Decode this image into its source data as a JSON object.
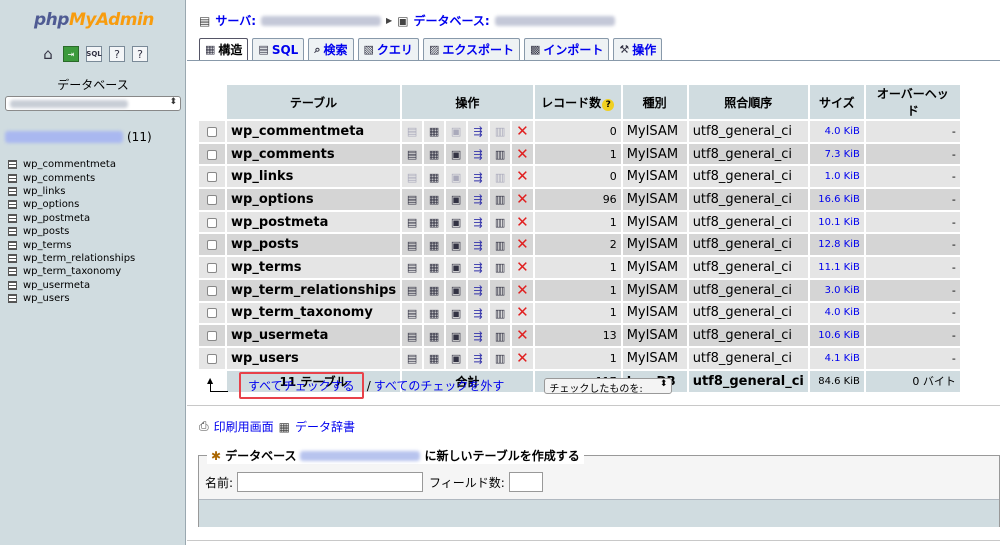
{
  "sidebar": {
    "logo": {
      "php": "php",
      "my": "My",
      "admin": "Admin"
    },
    "db_label": "データベース",
    "db_count": "(11)",
    "tables": [
      "wp_commentmeta",
      "wp_comments",
      "wp_links",
      "wp_options",
      "wp_postmeta",
      "wp_posts",
      "wp_terms",
      "wp_term_relationships",
      "wp_term_taxonomy",
      "wp_usermeta",
      "wp_users"
    ]
  },
  "breadcrumb": {
    "server_label": "サーバ:",
    "database_label": "データベース:"
  },
  "tabs": [
    {
      "label": "構造",
      "icon": "structure-icon"
    },
    {
      "label": "SQL",
      "icon": "sql-icon"
    },
    {
      "label": "検索",
      "icon": "search-icon"
    },
    {
      "label": "クエリ",
      "icon": "query-icon"
    },
    {
      "label": "エクスポート",
      "icon": "export-icon"
    },
    {
      "label": "インポート",
      "icon": "import-icon"
    },
    {
      "label": "操作",
      "icon": "operations-icon"
    }
  ],
  "table": {
    "headers": {
      "table": "テーブル",
      "actions": "操作",
      "records": "レコード数",
      "type": "種別",
      "collation": "照合順序",
      "size": "サイズ",
      "overhead": "オーバーヘッド"
    },
    "rows": [
      {
        "name": "wp_commentmeta",
        "records": "0",
        "type": "MyISAM",
        "collation": "utf8_general_ci",
        "size": "4.0 KiB",
        "overhead": "-",
        "empty": true
      },
      {
        "name": "wp_comments",
        "records": "1",
        "type": "MyISAM",
        "collation": "utf8_general_ci",
        "size": "7.3 KiB",
        "overhead": "-",
        "empty": false
      },
      {
        "name": "wp_links",
        "records": "0",
        "type": "MyISAM",
        "collation": "utf8_general_ci",
        "size": "1.0 KiB",
        "overhead": "-",
        "empty": true
      },
      {
        "name": "wp_options",
        "records": "96",
        "type": "MyISAM",
        "collation": "utf8_general_ci",
        "size": "16.6 KiB",
        "overhead": "-",
        "empty": false
      },
      {
        "name": "wp_postmeta",
        "records": "1",
        "type": "MyISAM",
        "collation": "utf8_general_ci",
        "size": "10.1 KiB",
        "overhead": "-",
        "empty": false
      },
      {
        "name": "wp_posts",
        "records": "2",
        "type": "MyISAM",
        "collation": "utf8_general_ci",
        "size": "12.8 KiB",
        "overhead": "-",
        "empty": false
      },
      {
        "name": "wp_terms",
        "records": "1",
        "type": "MyISAM",
        "collation": "utf8_general_ci",
        "size": "11.1 KiB",
        "overhead": "-",
        "empty": false
      },
      {
        "name": "wp_term_relationships",
        "records": "1",
        "type": "MyISAM",
        "collation": "utf8_general_ci",
        "size": "3.0 KiB",
        "overhead": "-",
        "empty": false
      },
      {
        "name": "wp_term_taxonomy",
        "records": "1",
        "type": "MyISAM",
        "collation": "utf8_general_ci",
        "size": "4.0 KiB",
        "overhead": "-",
        "empty": false
      },
      {
        "name": "wp_usermeta",
        "records": "13",
        "type": "MyISAM",
        "collation": "utf8_general_ci",
        "size": "10.6 KiB",
        "overhead": "-",
        "empty": false
      },
      {
        "name": "wp_users",
        "records": "1",
        "type": "MyISAM",
        "collation": "utf8_general_ci",
        "size": "4.1 KiB",
        "overhead": "-",
        "empty": false
      }
    ],
    "total": {
      "tables": "11 テーブル",
      "label": "合計",
      "records": "117",
      "type": "InnoDB",
      "collation": "utf8_general_ci",
      "size": "84.6 KiB",
      "overhead": "0 バイト"
    }
  },
  "check": {
    "all": "すべてチェックする",
    "separator": "/",
    "none": "すべてのチェックを外す",
    "with_selected": "チェックしたものを:"
  },
  "links": {
    "print": "印刷用画面",
    "dictionary": "データ辞書"
  },
  "create_table": {
    "legend_prefix": "データベース",
    "legend_suffix": "に新しいテーブルを作成する",
    "name_label": "名前:",
    "fields_label": "フィールド数:"
  },
  "colors": {
    "link": "#0000ee",
    "header_bg": "#d0dce0",
    "row_odd": "#e5e5e5",
    "row_even": "#d5d5d5",
    "highlight": "#e8424a",
    "drop": "#e02020"
  }
}
